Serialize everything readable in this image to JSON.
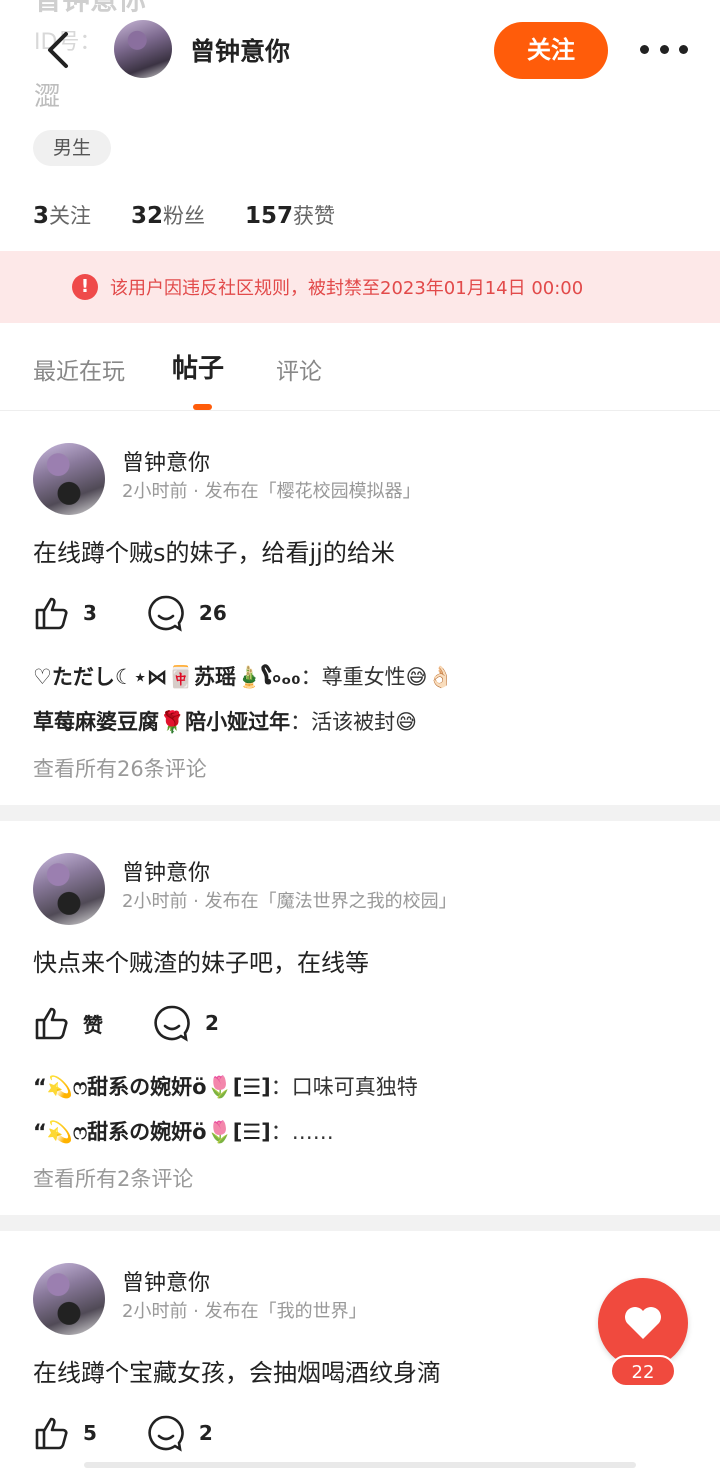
{
  "header": {
    "ghost_name": "曾钟意你",
    "ghost_id": "ID号：",
    "ghost_sig": "澀",
    "name": "曾钟意你",
    "follow_label": "关注"
  },
  "profile": {
    "gender": "男生",
    "stats": [
      {
        "num": "3",
        "label": "关注"
      },
      {
        "num": "32",
        "label": "粉丝"
      },
      {
        "num": "157",
        "label": "获赞"
      }
    ]
  },
  "ban_notice": {
    "icon": "!",
    "text": "该用户因违反社区规则，被封禁至2023年01月14日 00:00"
  },
  "tabs": [
    {
      "label": "最近在玩"
    },
    {
      "label": "帖子"
    },
    {
      "label": "评论"
    }
  ],
  "posts": [
    {
      "author": "曾钟意你",
      "meta": "2小时前 · 发布在「樱花校园模拟器」",
      "content": "在线蹲个贼s的妹子，给看jj的给米",
      "likes": "3",
      "comments": "26",
      "comment1_user": "♡ただし☾⋆⋈🀄苏瑶🎍ໂ৹ₒ₀",
      "comment1_text": "：尊重女性😅👌🏻",
      "comment2_user": "草莓麻婆豆腐🌹陪小娅过年",
      "comment2_text": "：活该被封😅",
      "view_all": "查看所有26条评论"
    },
    {
      "author": "曾钟意你",
      "meta": "2小时前 · 发布在「魔法世界之我的校园」",
      "content": "快点来个贼渣的妹子吧，在线等",
      "likes": "赞",
      "comments": "2",
      "comment1_user": "“💫ෆ甜系の婉妍ö🌷[☰]",
      "comment1_text": "：口味可真独特",
      "comment2_user": "“💫ෆ甜系の婉妍ö🌷[☰]",
      "comment2_text": "：……",
      "view_all": "查看所有2条评论"
    },
    {
      "author": "曾钟意你",
      "meta": "2小时前 · 发布在「我的世界」",
      "content": "在线蹲个宝藏女孩，会抽烟喝酒纹身滴",
      "likes": "5",
      "comments": "2"
    }
  ],
  "float_like": {
    "count": "22"
  },
  "colors": {
    "accent": "#ff5c0a",
    "ban_bg": "#fde8e8",
    "ban_text": "#e24a4a",
    "float": "#f04a3e"
  }
}
